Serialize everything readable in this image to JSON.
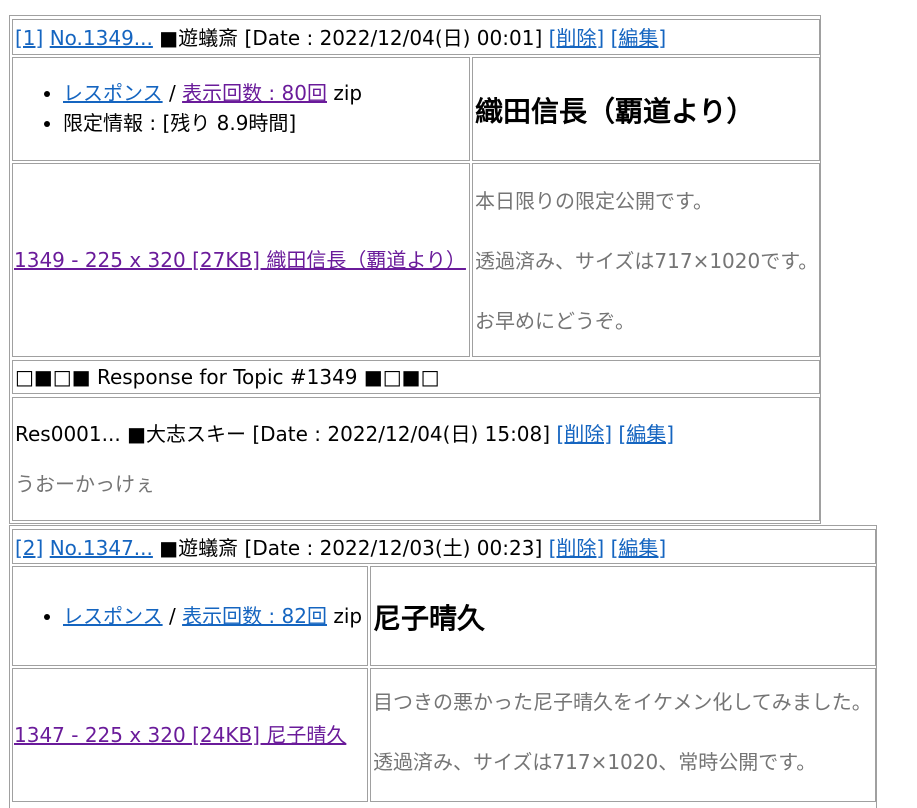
{
  "posts": [
    {
      "index_link": "[1]",
      "number_link": "No.1349...",
      "author": "■遊蟻斎",
      "date": "[Date : 2022/12/04(日) 00:01]",
      "delete_label": "[削除]",
      "edit_label": "[編集]",
      "response_label": "レスポンス",
      "separator": "/",
      "views_label": "表示回数 : 80回",
      "zip_label": "zip",
      "limit_info": "限定情報 : [残り 8.9時間]",
      "title": "織田信長（覇道より）",
      "thumb_link": "1349 - 225 x 320 [27KB] 織田信長（覇道より）",
      "description": [
        "本日限りの限定公開です。",
        "透過済み、サイズは717×1020です。",
        "お早めにどうぞ。"
      ],
      "response_header": "□■□■ Response for Topic #1349 ■□■□",
      "response": {
        "id": "Res0001...",
        "author": "■大志スキー",
        "date": "[Date : 2022/12/04(日) 15:08]",
        "delete_label": "[削除]",
        "edit_label": "[編集]",
        "text": "うおーかっけぇ"
      }
    },
    {
      "index_link": "[2]",
      "number_link": "No.1347...",
      "author": "■遊蟻斎",
      "date": "[Date : 2022/12/03(土) 00:23]",
      "delete_label": "[削除]",
      "edit_label": "[編集]",
      "response_label": "レスポンス",
      "separator": "/",
      "views_label": "表示回数 : 82回",
      "zip_label": "zip",
      "title": "尼子晴久",
      "thumb_link": "1347 - 225 x 320 [24KB] 尼子晴久",
      "description": [
        "目つきの悪かった尼子晴久をイケメン化してみました。",
        "透過済み、サイズは717×1020、常時公開です。"
      ]
    }
  ],
  "colors": {
    "link": "#1565c0",
    "visited_link": "#6a1b9a",
    "muted_text": "#757575",
    "border": "#a0a0a0"
  }
}
